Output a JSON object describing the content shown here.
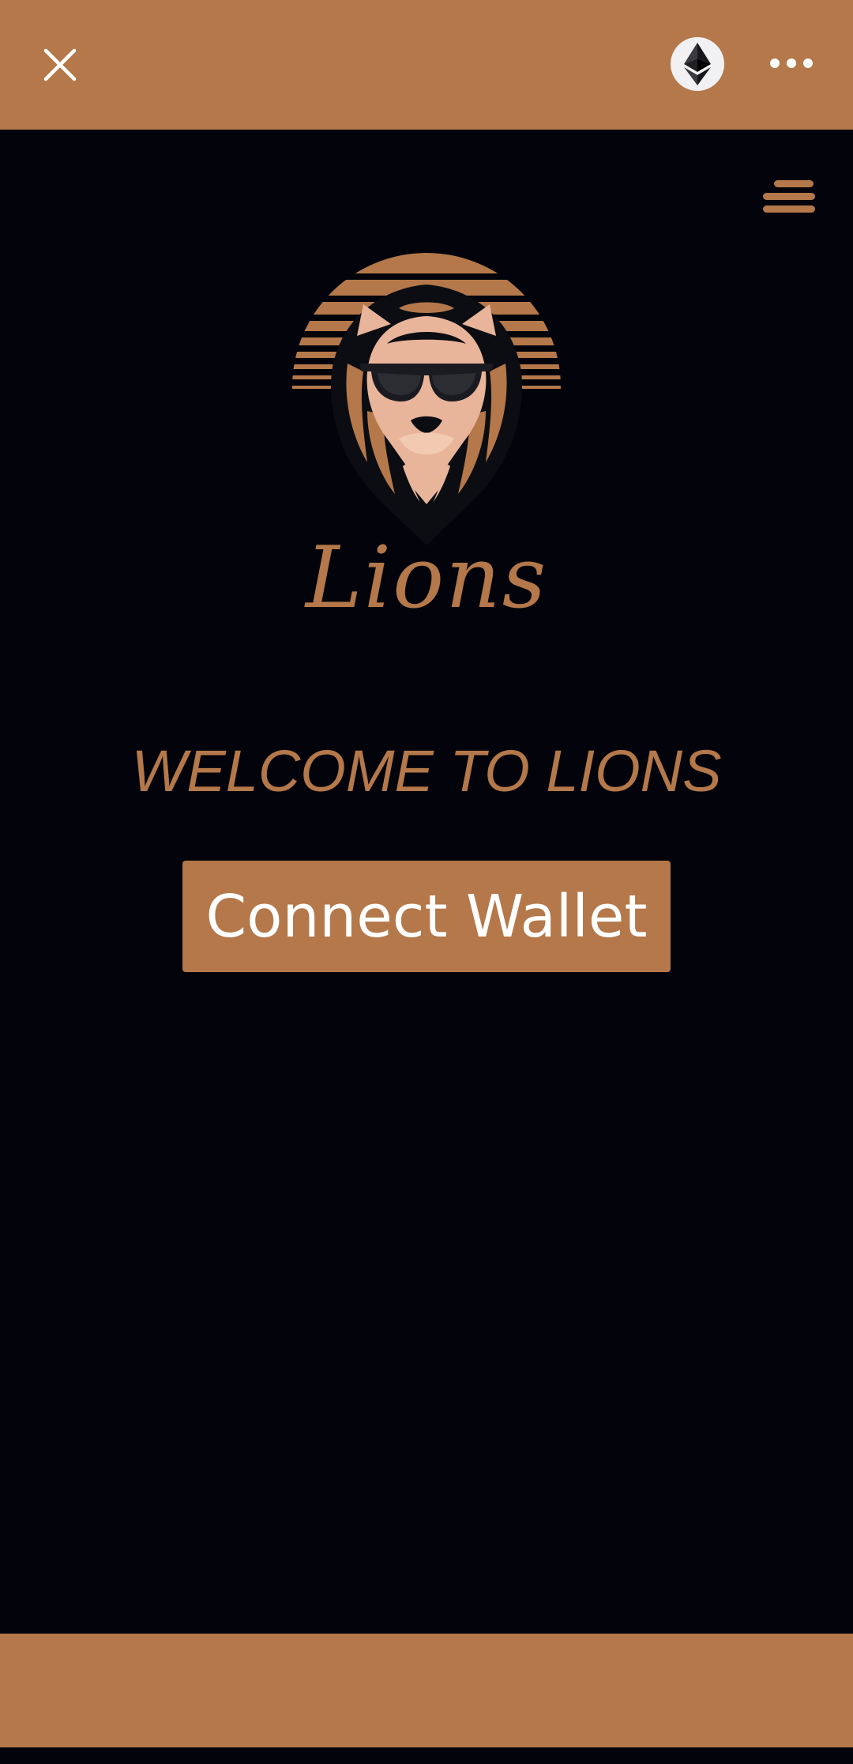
{
  "top_bar": {
    "close_icon": "close-icon",
    "network_icon": "ethereum-icon",
    "more_icon": "more-horizontal-icon"
  },
  "header": {
    "menu_icon": "hamburger-menu-icon"
  },
  "logo": {
    "icon": "lion-sunglasses-logo",
    "brand_name": "Lions"
  },
  "main": {
    "welcome_text": "WELCOME TO LIONS",
    "connect_button_label": "Connect Wallet"
  },
  "colors": {
    "accent": "#b4784a",
    "background": "#03040b",
    "text_on_accent": "#ffffff"
  }
}
